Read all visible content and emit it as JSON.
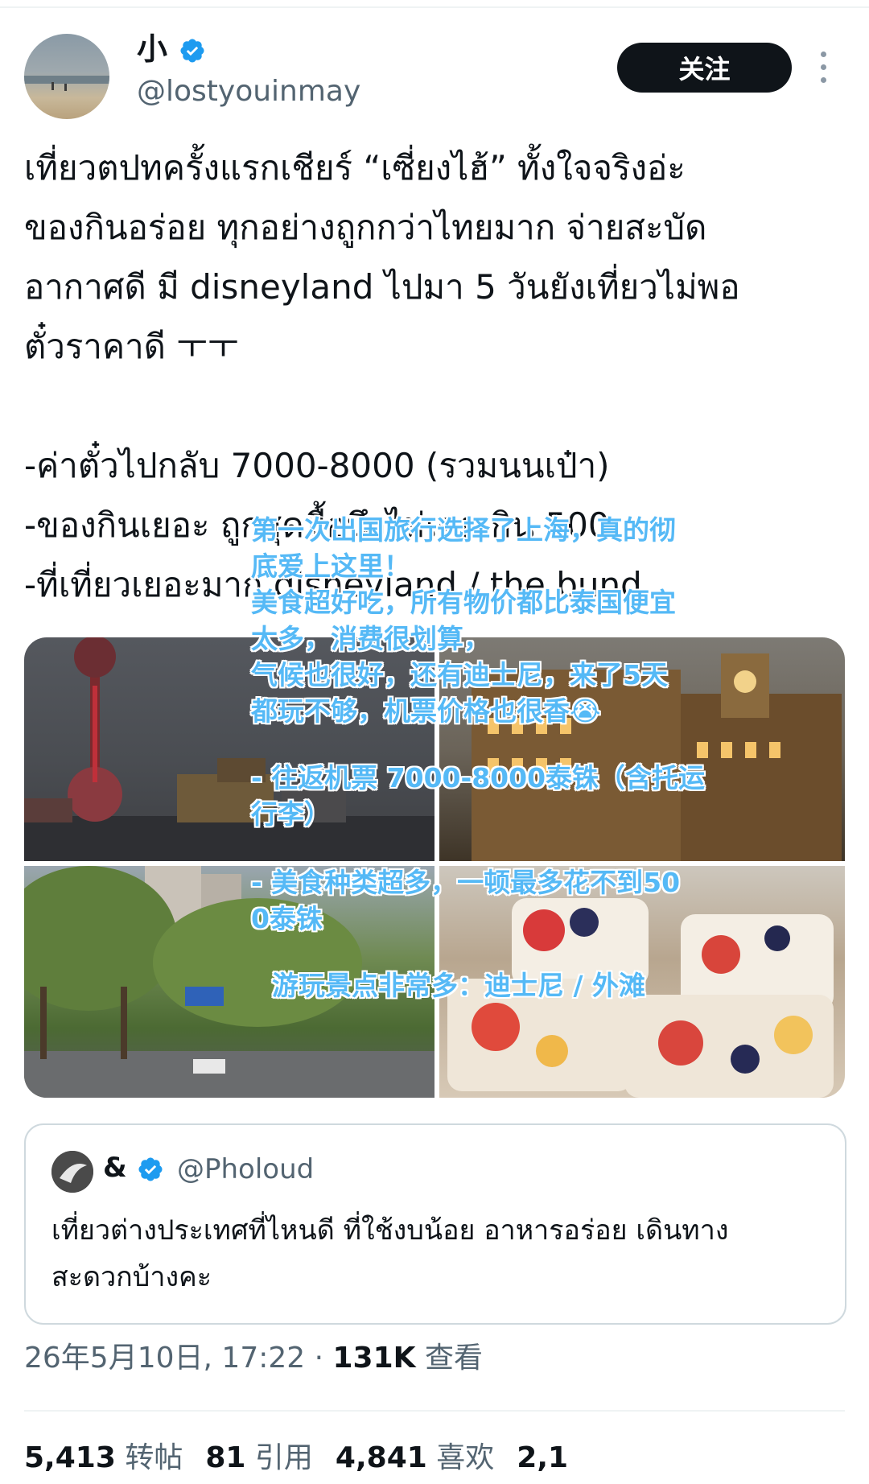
{
  "header": {
    "display_name": "小",
    "handle": "@lostyouinmay",
    "follow_label": "关注"
  },
  "tweet": {
    "lines": [
      "เที่ยวตปทครั้งแรกเชียร์ “เซี่ยงไฮ้” ทั้งใจจริงอ่ะ",
      "ของกินอร่อย ทุกอย่างถูกกว่าไทยมาก จ่ายสะบัด",
      "อากาศดี มี disneyland ไปมา 5 วันยังเที่ยวไม่พอ",
      "ตั๋วราคาดี ㅜㅜ",
      "",
      "-ค่าตั๋วไปกลับ 7000-8000 (รวมนนเป๋า)",
      "-ของกินเยอะ ถูกสุดมื้อนึงไม่เคยเกิน 500",
      "-ที่เที่ยวเยอะมาก disneyland / the bund"
    ]
  },
  "translation_overlay": {
    "block1": [
      "第一次出国旅行选择了上海，真的彻",
      "底爱上这里！",
      "美食超好吃，所有物价都比泰国便宜",
      "太多，消费很划算，",
      "气候也很好，还有迪士尼，来了5天",
      "都玩不够，机票价格也很香😭"
    ],
    "block2": [
      "- 往返机票 7000-8000泰铢（含托运",
      "行李）"
    ],
    "block3": [
      "- 美食种类超多，一顿最多花不到50",
      "0泰铢"
    ],
    "block4": "游玩景点非常多：迪士尼 / 外滩"
  },
  "quote": {
    "name": "&",
    "handle": "@Pholoud",
    "lines": [
      "เที่ยวต่างประเทศที่ไหนดี ที่ใช้งบน้อย อาหารอร่อย เดินทาง",
      "สะดวกบ้างคะ"
    ]
  },
  "meta": {
    "date": "26年5月10日, 17:22 · ",
    "views_count": "131K",
    "views_label": " 查看"
  },
  "stats": {
    "reposts_count": "5,413",
    "reposts_label": "转帖",
    "quotes_count": "81",
    "quotes_label": "引用",
    "likes_count": "4,841",
    "likes_label": "喜欢",
    "bookmarks_count": "2,1"
  },
  "colors": {
    "accent_blue": "#1d9bf0",
    "follow_bg": "#0f1419",
    "overlay_text": "#55b9f6"
  },
  "icons": {
    "verified": "verified-badge-icon",
    "more": "more-options-icon"
  }
}
